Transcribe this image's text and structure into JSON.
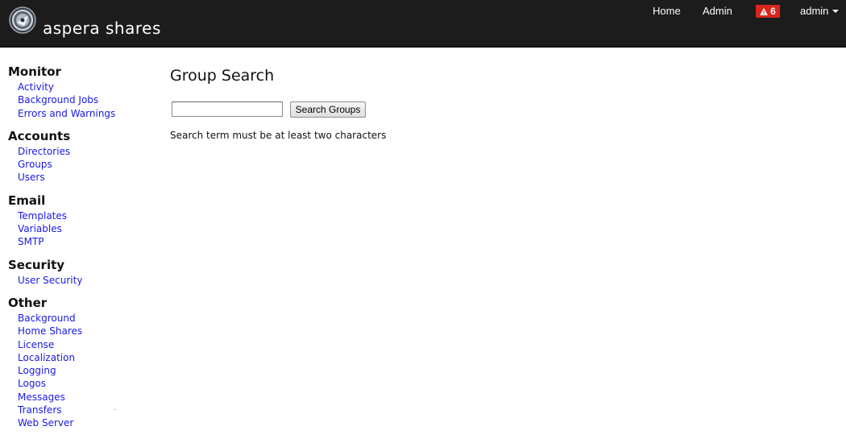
{
  "header": {
    "brand": "aspera shares",
    "nav": {
      "home": "Home",
      "admin": "Admin",
      "alerts_count": "6",
      "user": "admin"
    },
    "colors": {
      "bar": "#1c1c1c",
      "alert": "#d9251c"
    }
  },
  "sidebar": {
    "sections": [
      {
        "title": "Monitor",
        "items": [
          "Activity",
          "Background Jobs",
          "Errors and Warnings"
        ]
      },
      {
        "title": "Accounts",
        "items": [
          "Directories",
          "Groups",
          "Users"
        ]
      },
      {
        "title": "Email",
        "items": [
          "Templates",
          "Variables",
          "SMTP"
        ]
      },
      {
        "title": "Security",
        "items": [
          "User Security"
        ]
      },
      {
        "title": "Other",
        "items": [
          "Background",
          "Home Shares",
          "License",
          "Localization",
          "Logging",
          "Logos",
          "Messages",
          "Transfers",
          "Web Server"
        ]
      }
    ]
  },
  "main": {
    "title": "Group Search",
    "search": {
      "value": "",
      "placeholder": "",
      "button_label": "Search Groups"
    },
    "hint": "Search term must be at least two characters"
  }
}
